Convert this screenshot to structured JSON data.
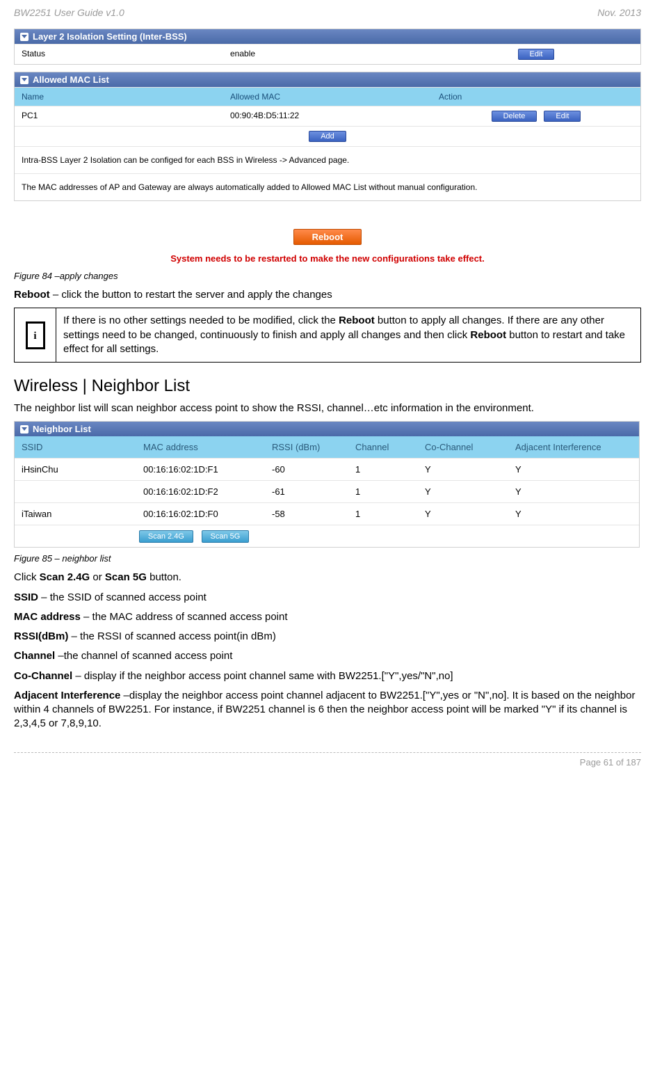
{
  "header": {
    "left": "BW2251 User Guide v1.0",
    "right": "Nov.  2013"
  },
  "layer2": {
    "title": "Layer 2 Isolation Setting (Inter-BSS)",
    "status_label": "Status",
    "status_value": "enable",
    "edit_btn": "Edit"
  },
  "maclist": {
    "title": "Allowed MAC List",
    "col_name": "Name",
    "col_mac": "Allowed MAC",
    "col_action": "Action",
    "row_name": "PC1",
    "row_mac": "00:90:4B:D5:11:22",
    "delete_btn": "Delete",
    "edit_btn": "Edit",
    "add_btn": "Add",
    "note1": "Intra-BSS Layer 2 Isolation can be configed for each BSS in Wireless -> Advanced page.",
    "note2": "The MAC addresses of AP and Gateway are always automatically added to Allowed MAC List without manual configuration."
  },
  "reboot": {
    "btn": "Reboot",
    "warning": "System needs to be restarted to make the new configurations take effect."
  },
  "fig84": "Figure 84 –apply changes",
  "reboot_line_prefix": "Reboot",
  "reboot_line_rest": " – click the button to restart the server and apply the changes",
  "info_note_p1": "If there is no other settings needed to be modified, click the ",
  "info_note_b1": "Reboot",
  "info_note_p2": " button to apply all changes. If there are any other settings need to be changed, continuously to finish and apply all changes and then click ",
  "info_note_b2": "Reboot",
  "info_note_p3": " button to restart and take effect for all settings.",
  "wireless_title": "Wireless | Neighbor List",
  "wireless_intro": "The neighbor list will scan neighbor access point to show the RSSI, channel…etc information in the environment.",
  "neighbor": {
    "title": "Neighbor List",
    "col_ssid": "SSID",
    "col_mac": "MAC address",
    "col_rssi": "RSSI (dBm)",
    "col_channel": "Channel",
    "col_co": "Co-Channel",
    "col_adj": "Adjacent Interference",
    "rows": [
      {
        "ssid": "iHsinChu",
        "mac": "00:16:16:02:1D:F1",
        "rssi": "-60",
        "channel": "1",
        "co": "Y",
        "adj": "Y"
      },
      {
        "ssid": "",
        "mac": "00:16:16:02:1D:F2",
        "rssi": "-61",
        "channel": "1",
        "co": "Y",
        "adj": "Y"
      },
      {
        "ssid": "iTaiwan",
        "mac": "00:16:16:02:1D:F0",
        "rssi": "-58",
        "channel": "1",
        "co": "Y",
        "adj": "Y"
      }
    ],
    "scan24": "Scan 2.4G",
    "scan5": "Scan 5G"
  },
  "fig85": "Figure 85 – neighbor list",
  "click_scan_p1": "Click ",
  "click_scan_b1": "Scan 2.4G",
  "click_scan_p2": " or ",
  "click_scan_b2": "Scan 5G",
  "click_scan_p3": " button.",
  "defs": {
    "ssid_b": "SSID",
    "ssid_r": " – the SSID of scanned access point",
    "mac_b": "MAC address",
    "mac_r": " – the MAC address of scanned access point",
    "rssi_b": "RSSI(dBm)",
    "rssi_r": " – the RSSI of scanned access point(in dBm)",
    "chan_b": "Channel",
    "chan_r": " –the channel of scanned access point",
    "co_b": "Co-Channel",
    "co_r": " – display if the neighbor access point channel same with BW2251.[\"Y\",yes/\"N\",no]",
    "adj_b": "Adjacent Interference",
    "adj_r": " –display the neighbor access point channel adjacent to BW2251.[\"Y\",yes or \"N\",no]. It is based on the neighbor within 4 channels of BW2251. For instance, if BW2251 channel is 6 then the neighbor access point will be marked \"Y\" if its channel is 2,3,4,5 or 7,8,9,10."
  },
  "footer": "Page 61 of 187"
}
